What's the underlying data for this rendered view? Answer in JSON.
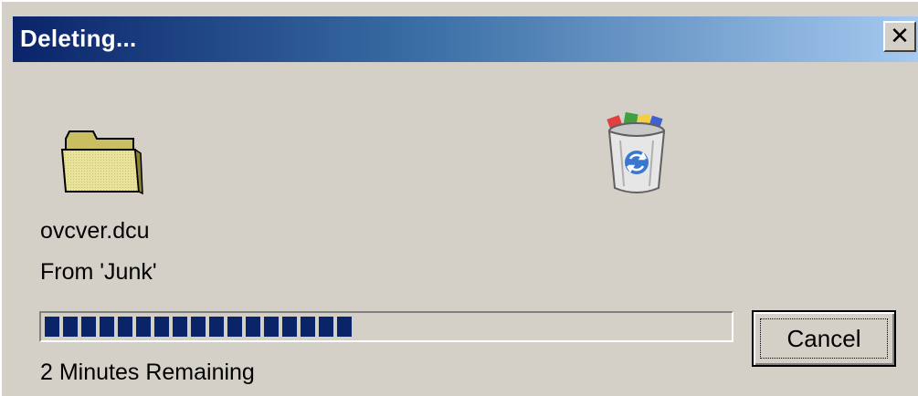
{
  "window": {
    "title": "Deleting...",
    "close_glyph": "✕"
  },
  "file": {
    "name": "ovcver.dcu",
    "from": "From 'Junk'"
  },
  "progress": {
    "fraction": 0.45,
    "fill_color": "#0a246a",
    "remaining_text": "2 Minutes Remaining"
  },
  "buttons": {
    "cancel_label": "Cancel"
  },
  "icons": {
    "source": "folder-icon",
    "destination": "recycle-bin-icon"
  }
}
